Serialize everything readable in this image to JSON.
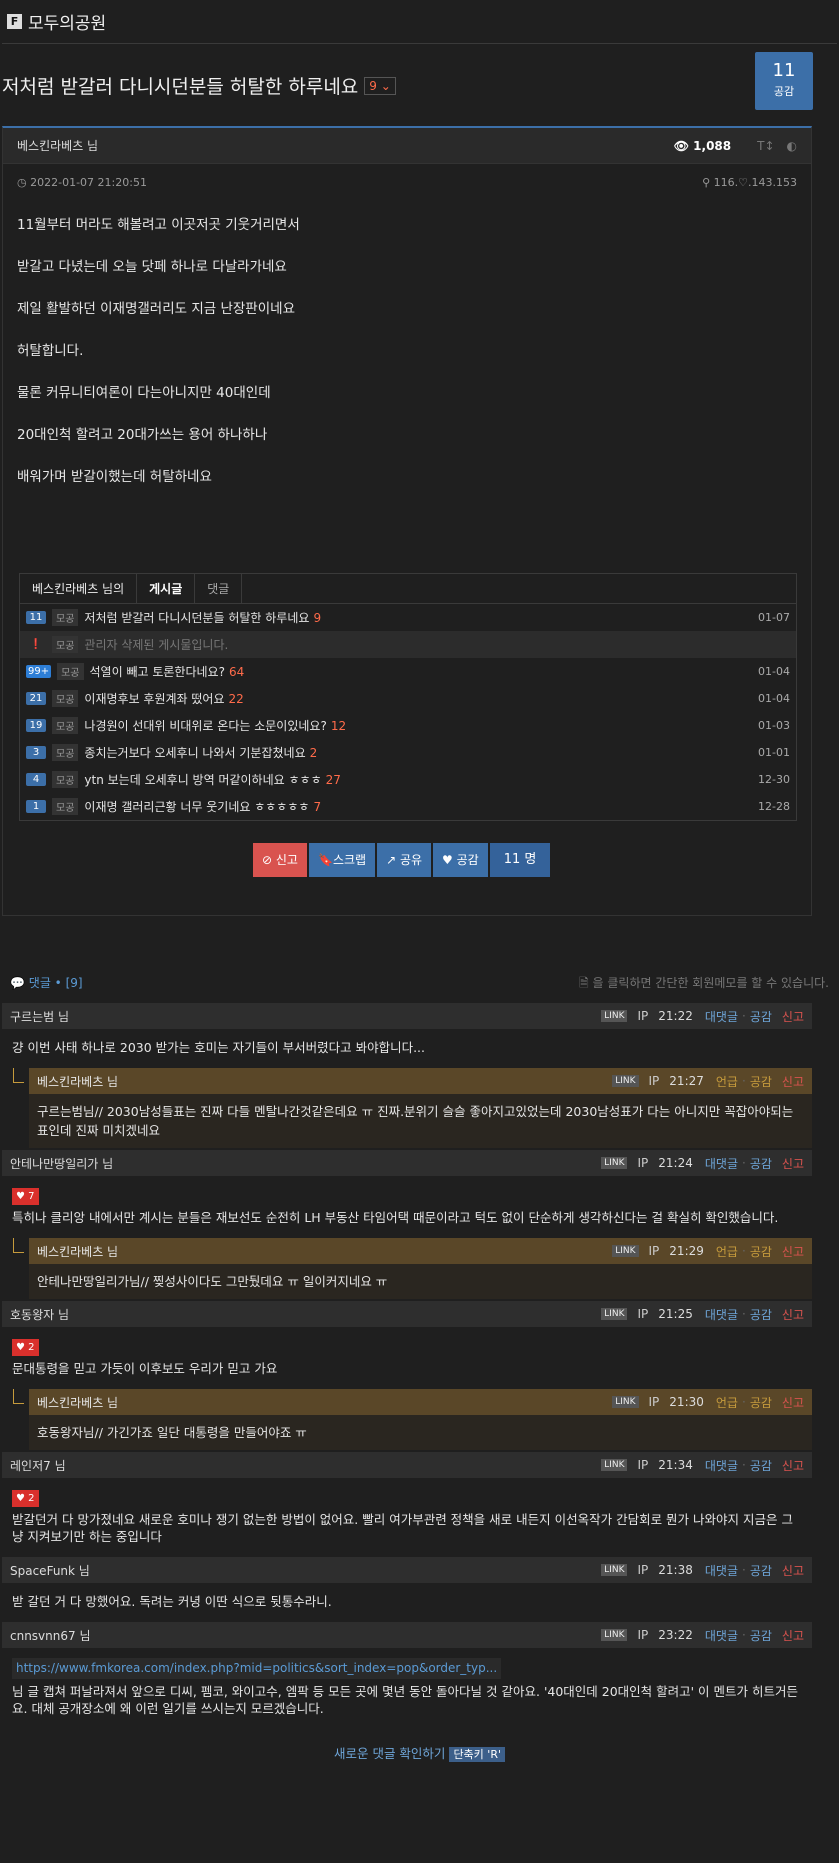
{
  "site": {
    "logo": "F",
    "name": "모두의공원"
  },
  "post": {
    "title": "저처럼 받갈러 다니시던분들 허탈한 하루네요",
    "comment_count": "9",
    "vote_count": "11",
    "vote_label": "공감",
    "author": "베스킨라베츠 님",
    "views": "1,088",
    "date": "2022-01-07 21:20:51",
    "ip": "116.♡.143.153",
    "body": [
      "11월부터 머라도 해볼려고 이곳저곳 기웃거리면서",
      "받갈고 다녔는데 오늘 닷페 하나로 다날라가네요",
      "제일 활발하던 이재명갤러리도 지금 난장판이네요",
      "허탈합니다.",
      "물론 커뮤니티여론이 다는아니지만 40대인데",
      "20대인척 할려고 20대가쓰는 용어 하나하나",
      "배워가며 받갈이했는데 허탈하네요"
    ]
  },
  "other": {
    "tab_author": "베스킨라베츠 님의",
    "tab_posts": "게시글",
    "tab_comments": "댓글",
    "rows": [
      {
        "badge": "11",
        "cat": "모공",
        "title": "저처럼 받갈러 다니시던분들 허탈한 하루네요",
        "cnt": "9",
        "date": "01-07"
      },
      {
        "badge": "",
        "cat": "모공",
        "title": "관리자 삭제된 게시물입니다.",
        "cnt": "",
        "date": ""
      },
      {
        "badge": "99+",
        "cat": "모공",
        "title": "석열이 빼고 토론한다네요?",
        "cnt": "64",
        "date": "01-04"
      },
      {
        "badge": "21",
        "cat": "모공",
        "title": "이재명후보 후원계좌 떴어요",
        "cnt": "22",
        "date": "01-04"
      },
      {
        "badge": "19",
        "cat": "모공",
        "title": "나경원이 선대위 비대위로 온다는 소문이있네요?",
        "cnt": "12",
        "date": "01-03"
      },
      {
        "badge": "3",
        "cat": "모공",
        "title": "종치는거보다 오세후니 나와서 기분잡쳤네요",
        "cnt": "2",
        "date": "01-01"
      },
      {
        "badge": "4",
        "cat": "모공",
        "title": "ytn 보는데 오세후니 방역 머같이하네요 ㅎㅎㅎ",
        "cnt": "27",
        "date": "12-30"
      },
      {
        "badge": "1",
        "cat": "모공",
        "title": "이재명 갤러리근황 너무 웃기네요 ㅎㅎㅎㅎㅎ",
        "cnt": "7",
        "date": "12-28"
      }
    ]
  },
  "buttons": {
    "report": "신고",
    "scrap": "스크랩",
    "share": "공유",
    "like": "공감",
    "like_count": "11 명"
  },
  "comments_head": {
    "label": "댓글 • [9]",
    "hint": "을 클릭하면 간단한 회원메모를 할 수 있습니다."
  },
  "labels": {
    "link": "LINK",
    "ip": "IP",
    "reply": "대댓글",
    "mention": "언급",
    "like": "공감",
    "report": "신고"
  },
  "comments": [
    {
      "name": "구르는범 님",
      "time": "21:22",
      "likes": "",
      "text": "걍 이번 사태 하나로 2030 받가는 호미는 자기들이 부서버렸다고 봐야합니다...",
      "reply": {
        "name": "베스킨라베츠 님",
        "time": "21:27",
        "text": "구르는범님// 2030남성들표는 진짜 다들 멘탈나간것같은데요 ㅠ 진짜.분위기 슬슬 좋아지고있었는데 2030남성표가 다는 아니지만 꼭잡아야되는 표인데 진짜 미치겠네요"
      }
    },
    {
      "name": "안테나만땅일리가 님",
      "time": "21:24",
      "likes": "7",
      "text": "특히나 클리앙 내에서만 계시는 분들은 재보선도 순전히 LH 부동산 타임어택 때문이라고 턱도 없이 단순하게 생각하신다는 걸 확실히 확인했습니다.",
      "reply": {
        "name": "베스킨라베츠 님",
        "time": "21:29",
        "text": "안테나만땅일리가님// 찢성사이다도 그만뒀데요 ㅠ 일이커지네요 ㅠ"
      }
    },
    {
      "name": "호동왕자 님",
      "time": "21:25",
      "likes": "2",
      "text": "문대통령을 믿고 가듯이 이후보도 우리가 믿고 가요",
      "reply": {
        "name": "베스킨라베츠 님",
        "time": "21:30",
        "text": "호동왕자님// 가긴가죠 일단 대통령을 만들어야죠 ㅠ"
      }
    },
    {
      "name": "레인저7 님",
      "time": "21:34",
      "likes": "2",
      "text": "받갈던거 다 망가졌네요 새로운 호미나 쟁기 없는한 방법이 없어요. 빨리 여가부관련 정책을 새로 내든지 이선옥작가 간담회로 뭔가 나와야지 지금은 그냥 지켜보기만 하는 중입니다"
    },
    {
      "name": "SpaceFunk 님",
      "time": "21:38",
      "likes": "",
      "text": "받 갈던 거 다 망했어요. 독려는 커녕 이딴 식으로 뒷통수라니."
    },
    {
      "name": "cnnsvnn67 님",
      "time": "23:22",
      "likes": "",
      "url": "https://www.fmkorea.com/index.php?mid=politics&sort_index=pop&order_typ...",
      "text": "님 글 캡쳐 퍼날라져서 앞으로 디씨, 펨코, 와이고수, 엠팍 등 모든 곳에 몇년 동안 돌아다닐 것 같아요. '40대인데 20대인척 할려고' 이 멘트가 히트거든요. 대체 공개장소에 왜 이런 일기를 쓰시는지 모르겠습니다."
    }
  ],
  "footer": {
    "new_comments": "새로운 댓글 확인하기",
    "shortcut": "단축키 'R'"
  }
}
